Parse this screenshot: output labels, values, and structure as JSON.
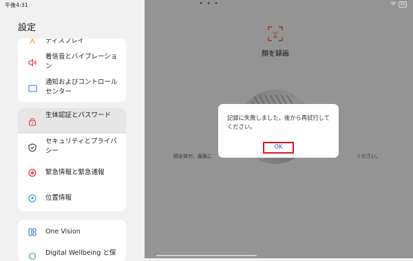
{
  "status_bar": {
    "time": "午後4:31",
    "center_dots": "• • •",
    "battery": "98"
  },
  "sidebar": {
    "title": "設定",
    "groups": [
      {
        "items": [
          {
            "label": "ディスプレイ",
            "icon": "display-icon"
          },
          {
            "label": "着信音とバイブレーション",
            "icon": "speaker-icon"
          },
          {
            "label": "通知およびコントロールセンター",
            "icon": "notification-icon"
          }
        ]
      },
      {
        "items": [
          {
            "label": "生体認証とパスワード",
            "icon": "lock-icon",
            "selected": true
          },
          {
            "label": "セキュリティとプライバシー",
            "icon": "shield-icon"
          },
          {
            "label": "緊急情報と緊急通報",
            "icon": "emergency-icon"
          },
          {
            "label": "位置情報",
            "icon": "location-icon"
          }
        ]
      },
      {
        "items": [
          {
            "label": "One Vision",
            "icon": "one-vision-icon"
          },
          {
            "label": "Digital Wellbeing と保",
            "icon": "wellbeing-icon"
          }
        ]
      }
    ]
  },
  "content": {
    "title": "顔を録画",
    "hint_left": "顔全体が、画面に",
    "hint_right": "ください。"
  },
  "dialog": {
    "message": "記録に失敗しました。後から再試行してください。",
    "ok_label": "OK"
  },
  "colors": {
    "accent": "#3554e6",
    "highlight_border": "#e0141e",
    "icon_red": "#e0303a",
    "icon_blue": "#3a6fd8",
    "icon_orange": "#f0a030"
  }
}
